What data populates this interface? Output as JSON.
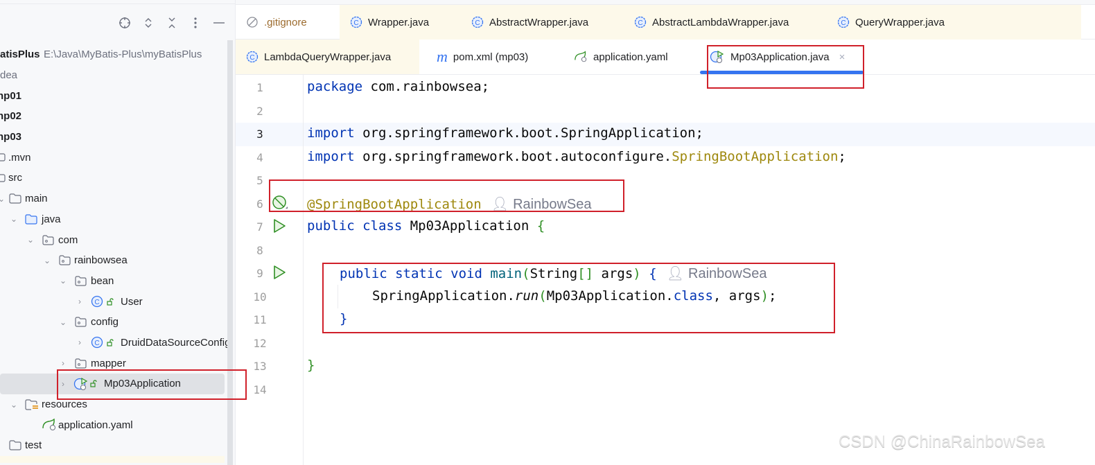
{
  "sidebar": {
    "toolbar": {
      "locate_icon": "crosshair-icon",
      "expand_icon": "expand-all-icon",
      "collapse_icon": "collapse-all-icon",
      "more_icon": "more-vertical-icon",
      "hide_icon": "minimize-icon"
    },
    "project": {
      "name": "atisPlus",
      "path": "E:\\Java\\MyBatis-Plus\\myBatisPlus"
    },
    "items": [
      {
        "label": "dea"
      },
      {
        "label": "np01"
      },
      {
        "label": "np02"
      },
      {
        "label": "np03"
      },
      {
        "label": ".mvn"
      },
      {
        "label": "src"
      },
      {
        "label": "main"
      },
      {
        "label": "java"
      },
      {
        "label": "com"
      },
      {
        "label": "rainbowsea"
      },
      {
        "label": "bean"
      },
      {
        "label": "User"
      },
      {
        "label": "config"
      },
      {
        "label": "DruidDataSourceConfig"
      },
      {
        "label": "mapper"
      },
      {
        "label": "Mp03Application"
      },
      {
        "label": "resources"
      },
      {
        "label": "application.yaml"
      },
      {
        "label": "test"
      }
    ]
  },
  "tabs": {
    "row1": [
      {
        "label": ".gitignore",
        "icon": "ignored-file-icon"
      },
      {
        "label": "Wrapper.java",
        "icon": "class-icon"
      },
      {
        "label": "AbstractWrapper.java",
        "icon": "class-icon"
      },
      {
        "label": "AbstractLambdaWrapper.java",
        "icon": "class-icon"
      },
      {
        "label": "QueryWrapper.java",
        "icon": "class-icon"
      }
    ],
    "row2": [
      {
        "label": "LambdaQueryWrapper.java",
        "icon": "class-icon"
      },
      {
        "label": "pom.xml (mp03)",
        "icon": "maven-icon"
      },
      {
        "label": "application.yaml",
        "icon": "spring-config-icon"
      },
      {
        "label": "Mp03Application.java",
        "icon": "spring-boot-class-icon",
        "active": true,
        "close": "×"
      }
    ]
  },
  "editor": {
    "line_numbers": [
      "1",
      "2",
      "3",
      "4",
      "5",
      "6",
      "7",
      "8",
      "9",
      "10",
      "11",
      "12",
      "13",
      "14"
    ],
    "lines": {
      "l1": {
        "kw": "package",
        "rest": " com.rainbowsea;"
      },
      "l3": {
        "kw": "import",
        "rest": " org.springframework.boot.SpringApplication;"
      },
      "l4": {
        "kw": "import",
        "rest": " org.springframework.boot.autoconfigure.",
        "ann": "SpringBootApplication",
        "end": ";"
      },
      "l6": {
        "ann": "@SpringBootApplication",
        "author": "RainbowSea"
      },
      "l7": {
        "kw": "public class",
        "name": " Mp03Application ",
        "brace": "{"
      },
      "l9": {
        "kw1": "public static void",
        "method": " main",
        "p1": "(",
        "type": "String",
        "br": "[]",
        "args": " args",
        "p2": ")",
        "brace": " {",
        "author": "RainbowSea"
      },
      "l10": {
        "cls": "SpringApplication.",
        "method": "run",
        "p1": "(",
        "arg": "Mp03Application.",
        "kw": "class",
        "rest": ", args",
        "p2": ")",
        "end": ";"
      },
      "l11": {
        "brace": "}"
      },
      "l13": {
        "brace": "}"
      }
    }
  },
  "watermark": "CSDN @ChinaRainbowSea"
}
